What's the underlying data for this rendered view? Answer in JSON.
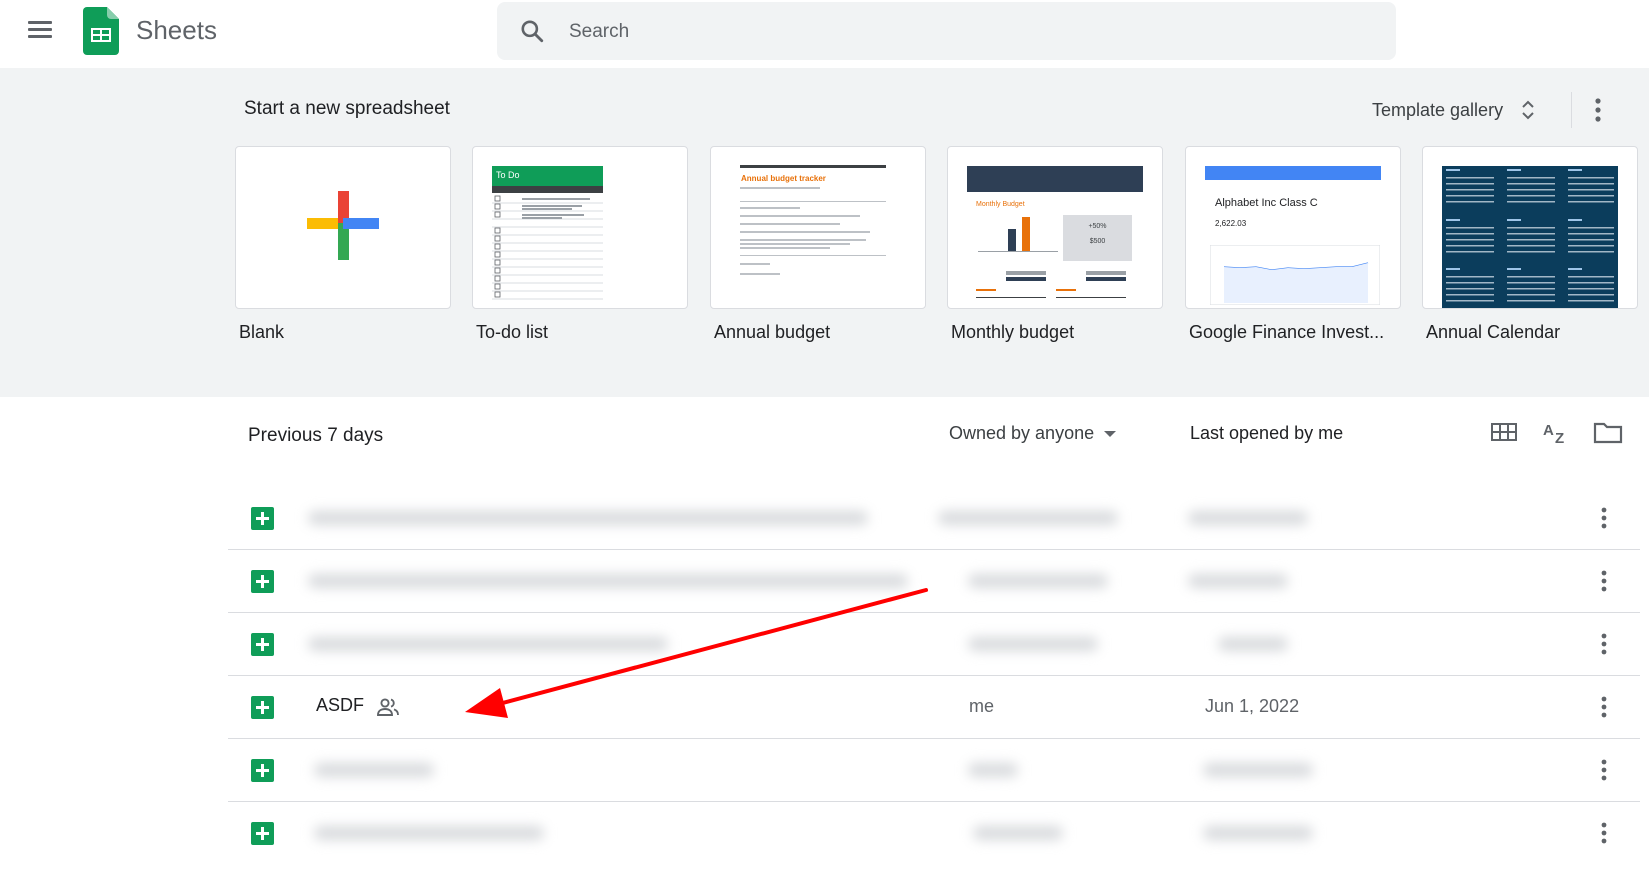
{
  "header": {
    "app_title": "Sheets",
    "search_placeholder": "Search"
  },
  "templates": {
    "section_title": "Start a new spreadsheet",
    "gallery_label": "Template gallery",
    "items": [
      {
        "label": "Blank"
      },
      {
        "label": "To-do list",
        "preview_title": "To Do"
      },
      {
        "label": "Annual budget",
        "preview_title": "Annual budget tracker"
      },
      {
        "label": "Monthly budget",
        "preview_title": "Monthly Budget",
        "preview_stat": "+50%",
        "preview_amount": "$500"
      },
      {
        "label": "Google Finance Invest...",
        "preview_title": "Alphabet Inc Class C",
        "preview_price": "2,622.03"
      },
      {
        "label": "Annual Calendar"
      }
    ]
  },
  "file_list": {
    "section_title": "Previous 7 days",
    "owner_filter": "Owned by anyone",
    "sort_label": "Last opened by me",
    "rows": [
      {
        "name": "",
        "owner": "",
        "date": "",
        "blurred": true
      },
      {
        "name": "",
        "owner": "",
        "date": "",
        "blurred": true
      },
      {
        "name": "",
        "owner": "",
        "date": "",
        "blurred": true
      },
      {
        "name": "ASDF",
        "owner": "me",
        "date": "Jun 1, 2022",
        "shared": true,
        "blurred": false
      },
      {
        "name": "",
        "owner": "",
        "date": "",
        "blurred": true
      },
      {
        "name": "",
        "owner": "",
        "date": "",
        "blurred": true
      }
    ]
  },
  "colors": {
    "sheets_green": "#0f9d58",
    "annotation_arrow": "#ff0000",
    "template_band_bg": "#f1f3f4"
  },
  "icons": [
    "menu-icon",
    "sheets-logo-icon",
    "search-icon",
    "unfold-icon",
    "more-vert-icon",
    "grid-view-icon",
    "sort-az-icon",
    "folder-icon",
    "sheets-file-icon",
    "people-icon"
  ]
}
